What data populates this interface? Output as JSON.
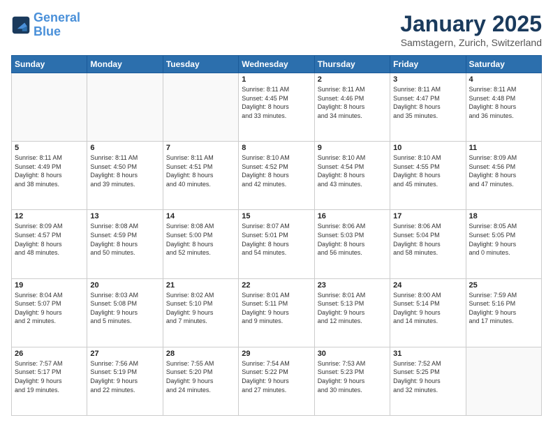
{
  "header": {
    "logo_line1": "General",
    "logo_line2": "Blue",
    "month": "January 2025",
    "location": "Samstagern, Zurich, Switzerland"
  },
  "days_of_week": [
    "Sunday",
    "Monday",
    "Tuesday",
    "Wednesday",
    "Thursday",
    "Friday",
    "Saturday"
  ],
  "weeks": [
    [
      {
        "day": "",
        "info": ""
      },
      {
        "day": "",
        "info": ""
      },
      {
        "day": "",
        "info": ""
      },
      {
        "day": "1",
        "info": "Sunrise: 8:11 AM\nSunset: 4:45 PM\nDaylight: 8 hours\nand 33 minutes."
      },
      {
        "day": "2",
        "info": "Sunrise: 8:11 AM\nSunset: 4:46 PM\nDaylight: 8 hours\nand 34 minutes."
      },
      {
        "day": "3",
        "info": "Sunrise: 8:11 AM\nSunset: 4:47 PM\nDaylight: 8 hours\nand 35 minutes."
      },
      {
        "day": "4",
        "info": "Sunrise: 8:11 AM\nSunset: 4:48 PM\nDaylight: 8 hours\nand 36 minutes."
      }
    ],
    [
      {
        "day": "5",
        "info": "Sunrise: 8:11 AM\nSunset: 4:49 PM\nDaylight: 8 hours\nand 38 minutes."
      },
      {
        "day": "6",
        "info": "Sunrise: 8:11 AM\nSunset: 4:50 PM\nDaylight: 8 hours\nand 39 minutes."
      },
      {
        "day": "7",
        "info": "Sunrise: 8:11 AM\nSunset: 4:51 PM\nDaylight: 8 hours\nand 40 minutes."
      },
      {
        "day": "8",
        "info": "Sunrise: 8:10 AM\nSunset: 4:52 PM\nDaylight: 8 hours\nand 42 minutes."
      },
      {
        "day": "9",
        "info": "Sunrise: 8:10 AM\nSunset: 4:54 PM\nDaylight: 8 hours\nand 43 minutes."
      },
      {
        "day": "10",
        "info": "Sunrise: 8:10 AM\nSunset: 4:55 PM\nDaylight: 8 hours\nand 45 minutes."
      },
      {
        "day": "11",
        "info": "Sunrise: 8:09 AM\nSunset: 4:56 PM\nDaylight: 8 hours\nand 47 minutes."
      }
    ],
    [
      {
        "day": "12",
        "info": "Sunrise: 8:09 AM\nSunset: 4:57 PM\nDaylight: 8 hours\nand 48 minutes."
      },
      {
        "day": "13",
        "info": "Sunrise: 8:08 AM\nSunset: 4:59 PM\nDaylight: 8 hours\nand 50 minutes."
      },
      {
        "day": "14",
        "info": "Sunrise: 8:08 AM\nSunset: 5:00 PM\nDaylight: 8 hours\nand 52 minutes."
      },
      {
        "day": "15",
        "info": "Sunrise: 8:07 AM\nSunset: 5:01 PM\nDaylight: 8 hours\nand 54 minutes."
      },
      {
        "day": "16",
        "info": "Sunrise: 8:06 AM\nSunset: 5:03 PM\nDaylight: 8 hours\nand 56 minutes."
      },
      {
        "day": "17",
        "info": "Sunrise: 8:06 AM\nSunset: 5:04 PM\nDaylight: 8 hours\nand 58 minutes."
      },
      {
        "day": "18",
        "info": "Sunrise: 8:05 AM\nSunset: 5:05 PM\nDaylight: 9 hours\nand 0 minutes."
      }
    ],
    [
      {
        "day": "19",
        "info": "Sunrise: 8:04 AM\nSunset: 5:07 PM\nDaylight: 9 hours\nand 2 minutes."
      },
      {
        "day": "20",
        "info": "Sunrise: 8:03 AM\nSunset: 5:08 PM\nDaylight: 9 hours\nand 5 minutes."
      },
      {
        "day": "21",
        "info": "Sunrise: 8:02 AM\nSunset: 5:10 PM\nDaylight: 9 hours\nand 7 minutes."
      },
      {
        "day": "22",
        "info": "Sunrise: 8:01 AM\nSunset: 5:11 PM\nDaylight: 9 hours\nand 9 minutes."
      },
      {
        "day": "23",
        "info": "Sunrise: 8:01 AM\nSunset: 5:13 PM\nDaylight: 9 hours\nand 12 minutes."
      },
      {
        "day": "24",
        "info": "Sunrise: 8:00 AM\nSunset: 5:14 PM\nDaylight: 9 hours\nand 14 minutes."
      },
      {
        "day": "25",
        "info": "Sunrise: 7:59 AM\nSunset: 5:16 PM\nDaylight: 9 hours\nand 17 minutes."
      }
    ],
    [
      {
        "day": "26",
        "info": "Sunrise: 7:57 AM\nSunset: 5:17 PM\nDaylight: 9 hours\nand 19 minutes."
      },
      {
        "day": "27",
        "info": "Sunrise: 7:56 AM\nSunset: 5:19 PM\nDaylight: 9 hours\nand 22 minutes."
      },
      {
        "day": "28",
        "info": "Sunrise: 7:55 AM\nSunset: 5:20 PM\nDaylight: 9 hours\nand 24 minutes."
      },
      {
        "day": "29",
        "info": "Sunrise: 7:54 AM\nSunset: 5:22 PM\nDaylight: 9 hours\nand 27 minutes."
      },
      {
        "day": "30",
        "info": "Sunrise: 7:53 AM\nSunset: 5:23 PM\nDaylight: 9 hours\nand 30 minutes."
      },
      {
        "day": "31",
        "info": "Sunrise: 7:52 AM\nSunset: 5:25 PM\nDaylight: 9 hours\nand 32 minutes."
      },
      {
        "day": "",
        "info": ""
      }
    ]
  ]
}
